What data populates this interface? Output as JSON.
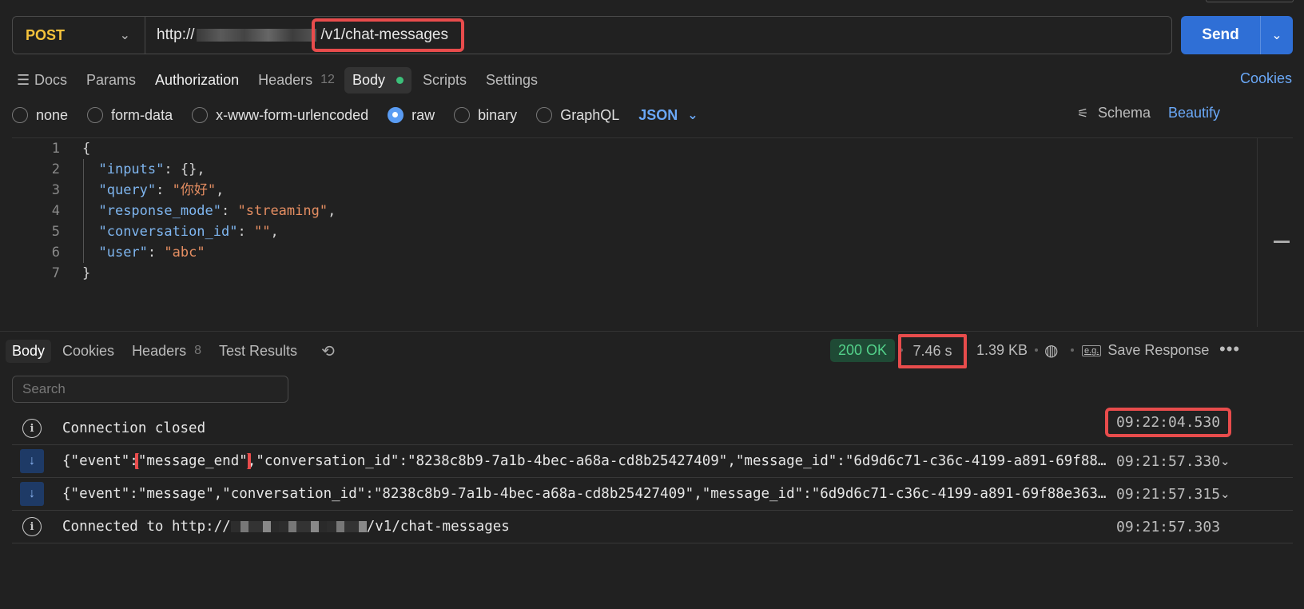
{
  "request": {
    "method": "POST",
    "url_prefix": "http://",
    "url_path": "/v1/chat-messages",
    "send_label": "Send"
  },
  "req_tabs": {
    "docs": "Docs",
    "params": "Params",
    "authorization": "Authorization",
    "headers": "Headers",
    "headers_count": "12",
    "body": "Body",
    "scripts": "Scripts",
    "settings": "Settings",
    "cookies": "Cookies"
  },
  "body_options": {
    "none": "none",
    "form_data": "form-data",
    "urlencoded": "x-www-form-urlencoded",
    "raw": "raw",
    "binary": "binary",
    "graphql": "GraphQL",
    "format": "JSON",
    "schema": "Schema",
    "beautify": "Beautify"
  },
  "editor": {
    "line_numbers": [
      "1",
      "2",
      "3",
      "4",
      "5",
      "6",
      "7"
    ],
    "lines": [
      {
        "open": "{"
      },
      {
        "key": "\"inputs\"",
        "rest": ": {},"
      },
      {
        "key": "\"query\"",
        "sep": ": ",
        "val": "\"你好\"",
        "end": ","
      },
      {
        "key": "\"response_mode\"",
        "sep": ": ",
        "val": "\"streaming\"",
        "end": ","
      },
      {
        "key": "\"conversation_id\"",
        "sep": ": ",
        "val": "\"\"",
        "end": ","
      },
      {
        "key": "\"user\"",
        "sep": ": ",
        "val": "\"abc\"",
        "end": ""
      },
      {
        "open": "}"
      }
    ]
  },
  "response": {
    "tabs": {
      "body": "Body",
      "cookies": "Cookies",
      "headers": "Headers",
      "headers_count": "8",
      "test_results": "Test Results"
    },
    "status": "200 OK",
    "time": "7.46 s",
    "size": "1.39 KB",
    "eg": "e.g.",
    "save_response": "Save Response",
    "search_placeholder": "Search",
    "messages": [
      {
        "type": "info",
        "text": "Connection closed",
        "time": "09:22:04.530"
      },
      {
        "type": "event",
        "pre": "{\"event\":",
        "highlight": "\"message_end\"",
        "post": ",\"conversation_id\":\"8238c8b9-7a1b-4bec-a68a-cd8b25427409\",\"message_id\":\"6d9d6c71-c36c-4199-a891-69f88...",
        "time": "09:21:57.330"
      },
      {
        "type": "event",
        "text": "{\"event\":\"message\",\"conversation_id\":\"8238c8b9-7a1b-4bec-a68a-cd8b25427409\",\"message_id\":\"6d9d6c71-c36c-4199-a891-69f88e363...",
        "time": "09:21:57.315"
      },
      {
        "type": "info",
        "pre": "Connected to http://",
        "post": "/v1/chat-messages",
        "time": "09:21:57.303"
      }
    ]
  }
}
